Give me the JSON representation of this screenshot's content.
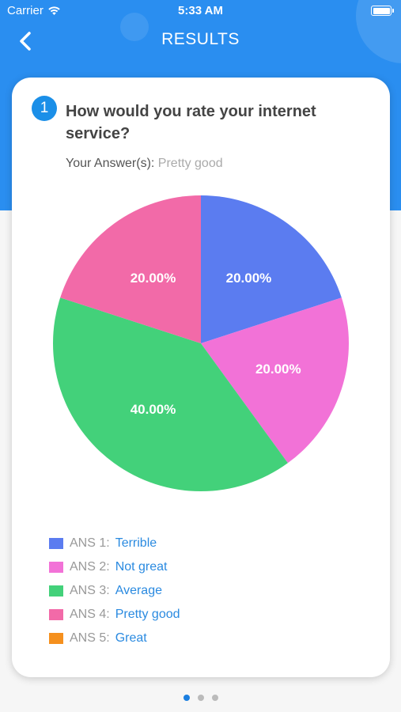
{
  "status_bar": {
    "carrier": "Carrier",
    "time": "5:33 AM",
    "wifi_icon": "wifi-icon",
    "battery_icon": "battery-icon"
  },
  "nav": {
    "title": "RESULTS",
    "back_icon": "chevron-left-icon"
  },
  "question": {
    "number": "1",
    "text": "How would you rate your internet service?",
    "answer_prefix": "Your Answer(s):",
    "answer_value": "Pretty good"
  },
  "chart_data": {
    "type": "pie",
    "title": "",
    "slices": [
      {
        "label": "Terrible",
        "value": 20,
        "display": "20.00%",
        "color": "#5b7cf0"
      },
      {
        "label": "Not great",
        "value": 20,
        "display": "20.00%",
        "color": "#f272d7"
      },
      {
        "label": "Average",
        "value": 40,
        "display": "40.00%",
        "color": "#43d17a"
      },
      {
        "label": "Pretty good",
        "value": 20,
        "display": "20.00%",
        "color": "#f26aa8"
      }
    ]
  },
  "legend": [
    {
      "prefix": "ANS 1:",
      "label": "Terrible",
      "color": "#5b7cf0"
    },
    {
      "prefix": "ANS 2:",
      "label": "Not great",
      "color": "#f272d7"
    },
    {
      "prefix": "ANS 3:",
      "label": "Average",
      "color": "#43d17a"
    },
    {
      "prefix": "ANS 4:",
      "label": "Pretty good",
      "color": "#f26aa8"
    },
    {
      "prefix": "ANS 5:",
      "label": "Great",
      "color": "#f5901e"
    }
  ],
  "pagination": {
    "count": 3,
    "active": 0
  },
  "colors": {
    "header_blue": "#2a8ef0",
    "accent": "#1b8fe8",
    "link": "#2a8ae0"
  }
}
